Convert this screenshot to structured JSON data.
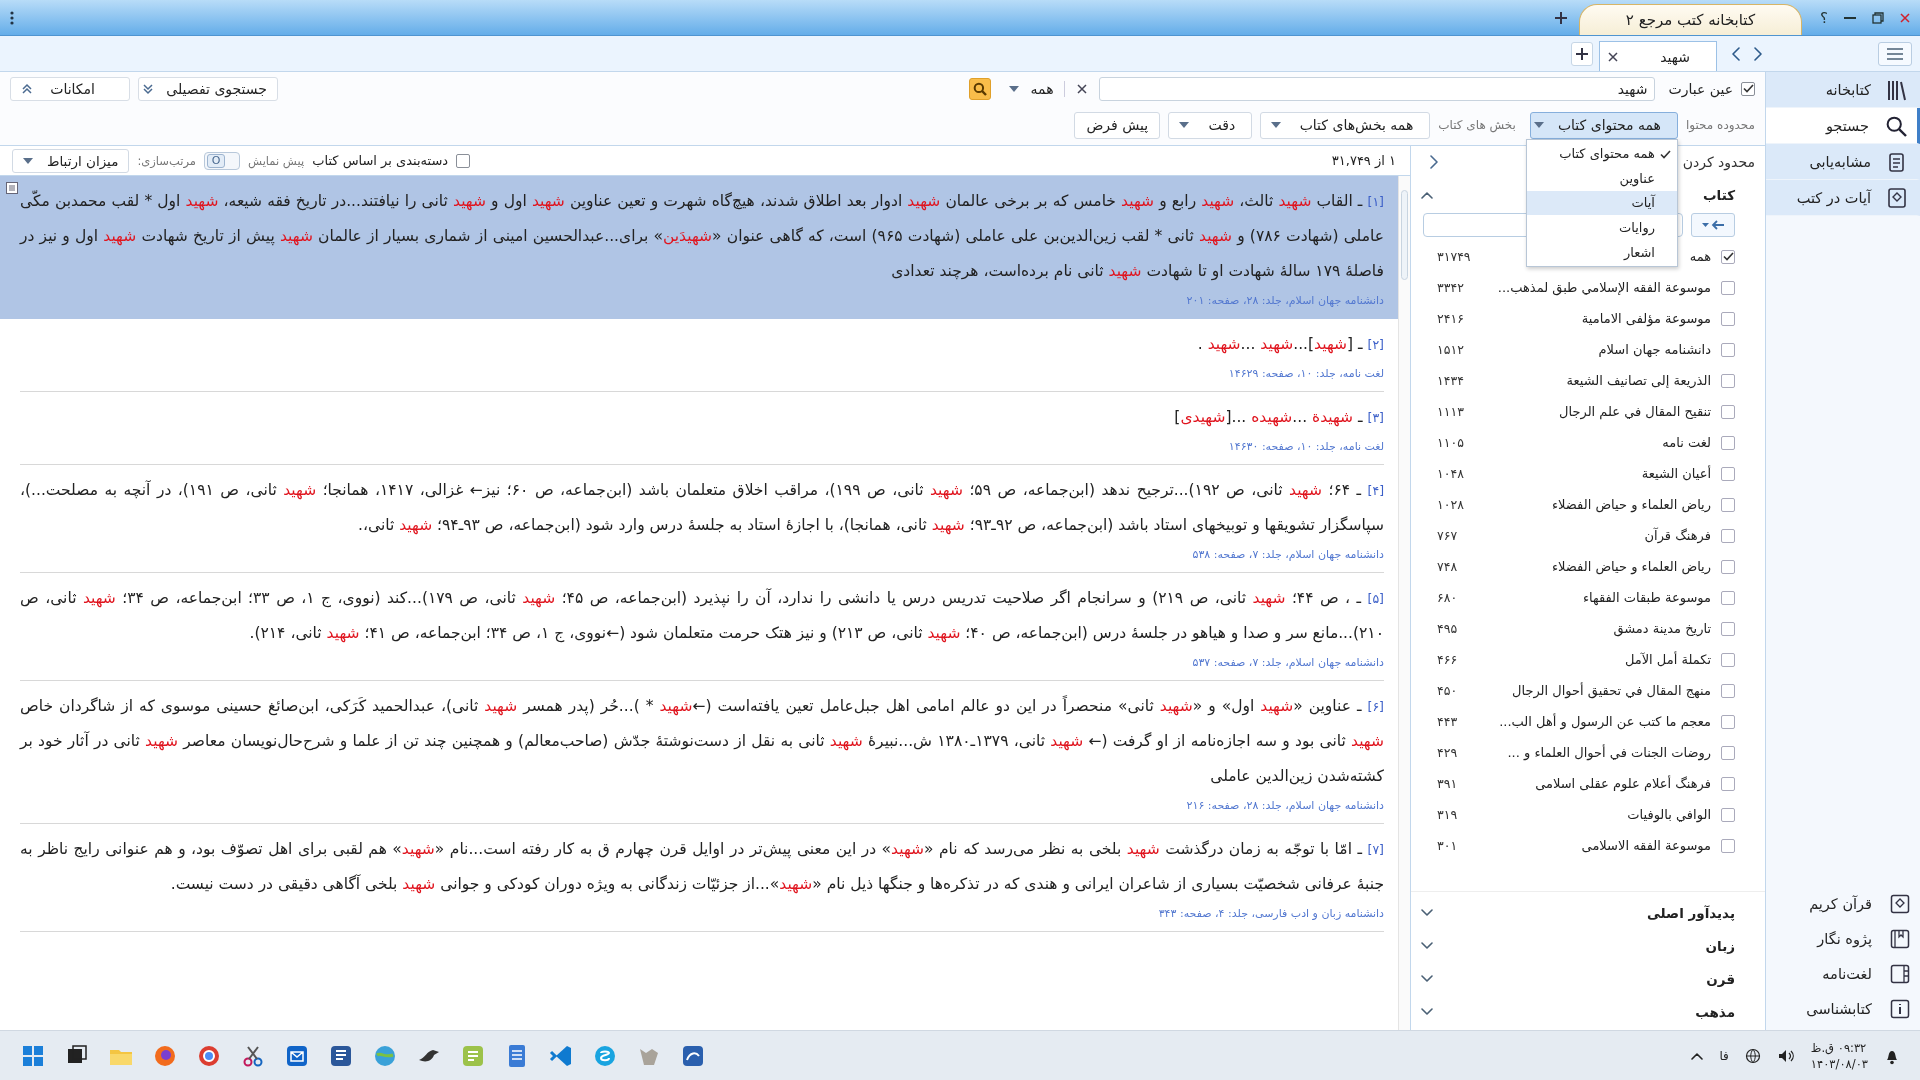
{
  "window": {
    "title": "کتابخانه کتب مرجع ۲",
    "help_button": "؟"
  },
  "tabs": [
    {
      "label": "شهید",
      "selected": true
    }
  ],
  "sidebar": {
    "items": [
      {
        "label": "کتابخانه",
        "selected": false
      },
      {
        "label": "جستجو",
        "selected": true
      },
      {
        "label": "مشابه‌یابی",
        "selected": false
      },
      {
        "label": "آیات در کتب",
        "selected": false
      }
    ],
    "bottom_items": [
      {
        "label": "قرآن کریم"
      },
      {
        "label": "پژوه نگار"
      },
      {
        "label": "لغت‌نامه"
      },
      {
        "label": "کتابشناسی"
      }
    ]
  },
  "search": {
    "exact_phrase": {
      "label": "عین عبارت",
      "checked": true
    },
    "query": "شهید",
    "scope": "همه",
    "detailed_button": "جستجوی تفصیلی",
    "options_button": "امکانات"
  },
  "filters": {
    "content_range_label": "محدوده محتوا",
    "content_range": "همه محتوای کتاب",
    "book_sections_label": "بخش های کتاب",
    "book_sections": "همه بخش‌های کتاب",
    "precision": "دقت",
    "default_button": "پیش فرض"
  },
  "content_menu": [
    {
      "label": "همه محتوای کتاب",
      "checked": true,
      "selected": false
    },
    {
      "label": "عناوین",
      "checked": false,
      "selected": false
    },
    {
      "label": "آیات",
      "checked": false,
      "selected": true
    },
    {
      "label": "روایات",
      "checked": false,
      "selected": false
    },
    {
      "label": "اشعار",
      "checked": false,
      "selected": false
    }
  ],
  "results_bar": {
    "count": "۱ از ۳۱,۷۴۹",
    "group_by_book": {
      "label": "دسته‌بندی بر اساس کتاب",
      "checked": false
    },
    "preview_label": "پیش نمایش",
    "preview_toggle": {
      "text": "O",
      "on": false
    },
    "sort_label": "مرتب‌سازی:",
    "sort": "میزان ارتباط"
  },
  "results": [
    {
      "number": "[۱]",
      "selected": true,
      "text": "ـ القاب **شهید** ثالث، **شهید** رابع و **شهید** خامس که بر برخی عالمان **شهید** ادوار بعد اطلاق شدند، هیچ‌گاه شهرت و تعین عناوین **شهید** اول و **شهید** ثانی را نیافتند...در تاریخ فقه شیعه، **شهید** اول * لقب محمدبن مکّی عاملی (شهادت ۷۸۶) و **شهید** ثانی * لقب زین‌الدین‌بن علی عاملی (شهادت ۹۶۵) است، که گاهی عنوان «**شهیدَین**» برای...عبدالحسین امینی از شماری بسیار از عالمان **شهید** پیش از تاریخ شهادت **شهید** اول و نیز در فاصلهٔ ۱۷۹ سالهٔ شهادت او تا شهادت **شهید** ثانی نام برده‌است، هرچند تعدادی",
      "source": "دانشنامه جهان اسلام، جلد: ۲۸، صفحه: ۲۰۱"
    },
    {
      "number": "[۲]",
      "selected": false,
      "text": "ـ [**شهید**]...**شهید** ...**شهید** .",
      "source": "لغت نامه، جلد: ۱۰، صفحه: ۱۴۶۲۹"
    },
    {
      "number": "[۳]",
      "selected": false,
      "text": "ـ **شهیدة** ...**شهیده** ...[**شهیدی**]",
      "source": "لغت نامه، جلد: ۱۰، صفحه: ۱۴۶۳۰"
    },
    {
      "number": "[۴]",
      "selected": false,
      "text": "ـ ۶۴؛ **شهید** ثانی، ص ۱۹۲)...ترجیح ندهد (ابن‌جماعه، ص ۵۹؛ **شهید** ثانی، ص ۱۹۹)، مراقب اخلاق متعلمان باشد (ابن‌جماعه، ص ۶۰؛ نیز← غزالی، ۱۴۱۷، همانجا؛ **شهید** ثانی، ص ۱۹۱)، در آنچه به مصلحت...)، سپاسگزار تشویقها و توبیخهای استاد باشد (ابن‌جماعه، ص ۹۲ـ۹۳؛ **شهید** ثانی، همانجا)، با اجازهٔ استاد به جلسهٔ درس وارد شود (ابن‌جماعه، ص ۹۳ـ۹۴؛ **شهید** ثانی،.",
      "source": "دانشنامه جهان اسلام، جلد: ۷، صفحه: ۵۳۸"
    },
    {
      "number": "[۵]",
      "selected": false,
      "text": "ـ ، ص ۴۴؛ **شهید** ثانی، ص ۲۱۹) و سرانجام اگر صلاحیت تدریس درس یا دانشی را ندارد، آن را نپذیرد (ابن‌جماعه، ص ۴۵؛ **شهید** ثانی، ص ۱۷۹)...کند (نووی، ج ۱، ص ۳۳؛ ابن‌جماعه، ص ۳۴؛ **شهید** ثانی، ص ۲۱۰)...مانع سر و صدا و هیاهو در جلسهٔ درس (ابن‌جماعه، ص ۴۰؛ **شهید** ثانی، ص ۲۱۳) و نیز هتک حرمت متعلمان شود (←نووی، ج ۱، ص ۳۴؛ ابن‌جماعه، ص ۴۱؛ **شهید** ثانی، ۲۱۴).",
      "source": "دانشنامه جهان اسلام، جلد: ۷، صفحه: ۵۳۷"
    },
    {
      "number": "[۶]",
      "selected": false,
      "text": "ـ عناوین «**شهید** اول» و «**شهید** ثانی» منحصراً در این دو عالم امامی اهل جبل‌عامل تعین یافته‌است (←**شهید** * )...حُر (پدر همسر **شهید** ثانی)، عبدالحمید کَرَکی، ابن‌صائغ حسینی موسوی که از شاگردان خاص **شهید** ثانی بود و سه اجازه‌نامه از او گرفت (← **شهید** ثانی، ۱۳۷۹ـ۱۳۸۰ ش...نبیرهٔ **شهید** ثانی به نقل از دست‌نوشتهٔ جدّش (صاحب‌معالم) و همچنین چند تن از علما و شرح‌حال‌نویسان معاصر **شهید** ثانی در آثار خود بر کشته‌شدن زین‌الدین عاملی",
      "source": "دانشنامه جهان اسلام، جلد: ۲۸، صفحه: ۲۱۶"
    },
    {
      "number": "[۷]",
      "selected": false,
      "text": "ـ امّا با توجّه به زمان درگذشت **شهید** بلخی به نظر می‌رسد که نام «**شهید**» در این معنی پیش‌تر در اوایل قرن چهارم ق به کار رفته است...نام «**شهید**» هم لقبی برای اهل تصوّف بود، و هم عنوانی رایج ناظر به جنبهٔ عرفانی شخصیّت بسیاری از شاعران ایرانی و هندی که در تذکره‌ها و جنگها ذیل نام «**شهید**»...از جزئیّات زندگانی به ویژه دوران کودکی و جوانی **شهید** بلخی آگاهی دقیقی در دست نیست.",
      "source": "دانشنامه زبان و ادب فارسی، جلد: ۴، صفحه: ۳۴۳"
    }
  ],
  "refine": {
    "title": "محدود کردن",
    "sections": [
      {
        "title": "کتاب",
        "expanded": true,
        "items": [
          {
            "label": "همه",
            "count": "۳۱۷۴۹",
            "checked": true
          },
          {
            "label": "موسوعة الفقه الإسلامي طبق لمذهب...",
            "count": "۳۳۴۲",
            "checked": false
          },
          {
            "label": "موسوعة مؤلفی الامامیة",
            "count": "۲۴۱۶",
            "checked": false
          },
          {
            "label": "دانشنامه جهان اسلام",
            "count": "۱۵۱۲",
            "checked": false
          },
          {
            "label": "الذریعة إلی تصانیف الشیعة",
            "count": "۱۴۳۴",
            "checked": false
          },
          {
            "label": "تنقیح المقال في علم الرجال",
            "count": "۱۱۱۳",
            "checked": false
          },
          {
            "label": "لغت نامه",
            "count": "۱۱۰۵",
            "checked": false
          },
          {
            "label": "أعیان الشیعة",
            "count": "۱۰۴۸",
            "checked": false
          },
          {
            "label": "ریاض العلماء و حیاض الفضلاء",
            "count": "۱۰۲۸",
            "checked": false
          },
          {
            "label": "فرهنگ قرآن",
            "count": "۷۶۷",
            "checked": false
          },
          {
            "label": "ریاض العلماء و حیاض الفضلاء",
            "count": "۷۴۸",
            "checked": false
          },
          {
            "label": "موسوعة طبقات الفقهاء",
            "count": "۶۸۰",
            "checked": false
          },
          {
            "label": "تاریخ مدینة دمشق",
            "count": "۴۹۵",
            "checked": false
          },
          {
            "label": "تکملة أمل الآمل",
            "count": "۴۶۶",
            "checked": false
          },
          {
            "label": "منهج المقال في تحقیق أحوال الرجال",
            "count": "۴۵۰",
            "checked": false
          },
          {
            "label": "معجم ما كتب عن الرسول و أهل الب...",
            "count": "۴۴۳",
            "checked": false
          },
          {
            "label": "روضات الجنات في أحوال العلماء و ...",
            "count": "۴۲۹",
            "checked": false
          },
          {
            "label": "فرهنگ أعلام علوم عقلی اسلامی",
            "count": "۳۹۱",
            "checked": false
          },
          {
            "label": "الوافي بالوفیات",
            "count": "۳۱۹",
            "checked": false
          },
          {
            "label": "موسوعة الفقه الاسلامی",
            "count": "۳۰۱",
            "checked": false
          }
        ]
      },
      {
        "title": "پدیدآور اصلی",
        "expanded": false
      },
      {
        "title": "زبان",
        "expanded": false
      },
      {
        "title": "قرن",
        "expanded": false
      },
      {
        "title": "مذهب",
        "expanded": false
      }
    ]
  },
  "taskbar": {
    "language": "فا",
    "time": "۰۹:۳۲ ق.ظ",
    "date": "۱۴۰۳/۰۸/۰۳"
  }
}
